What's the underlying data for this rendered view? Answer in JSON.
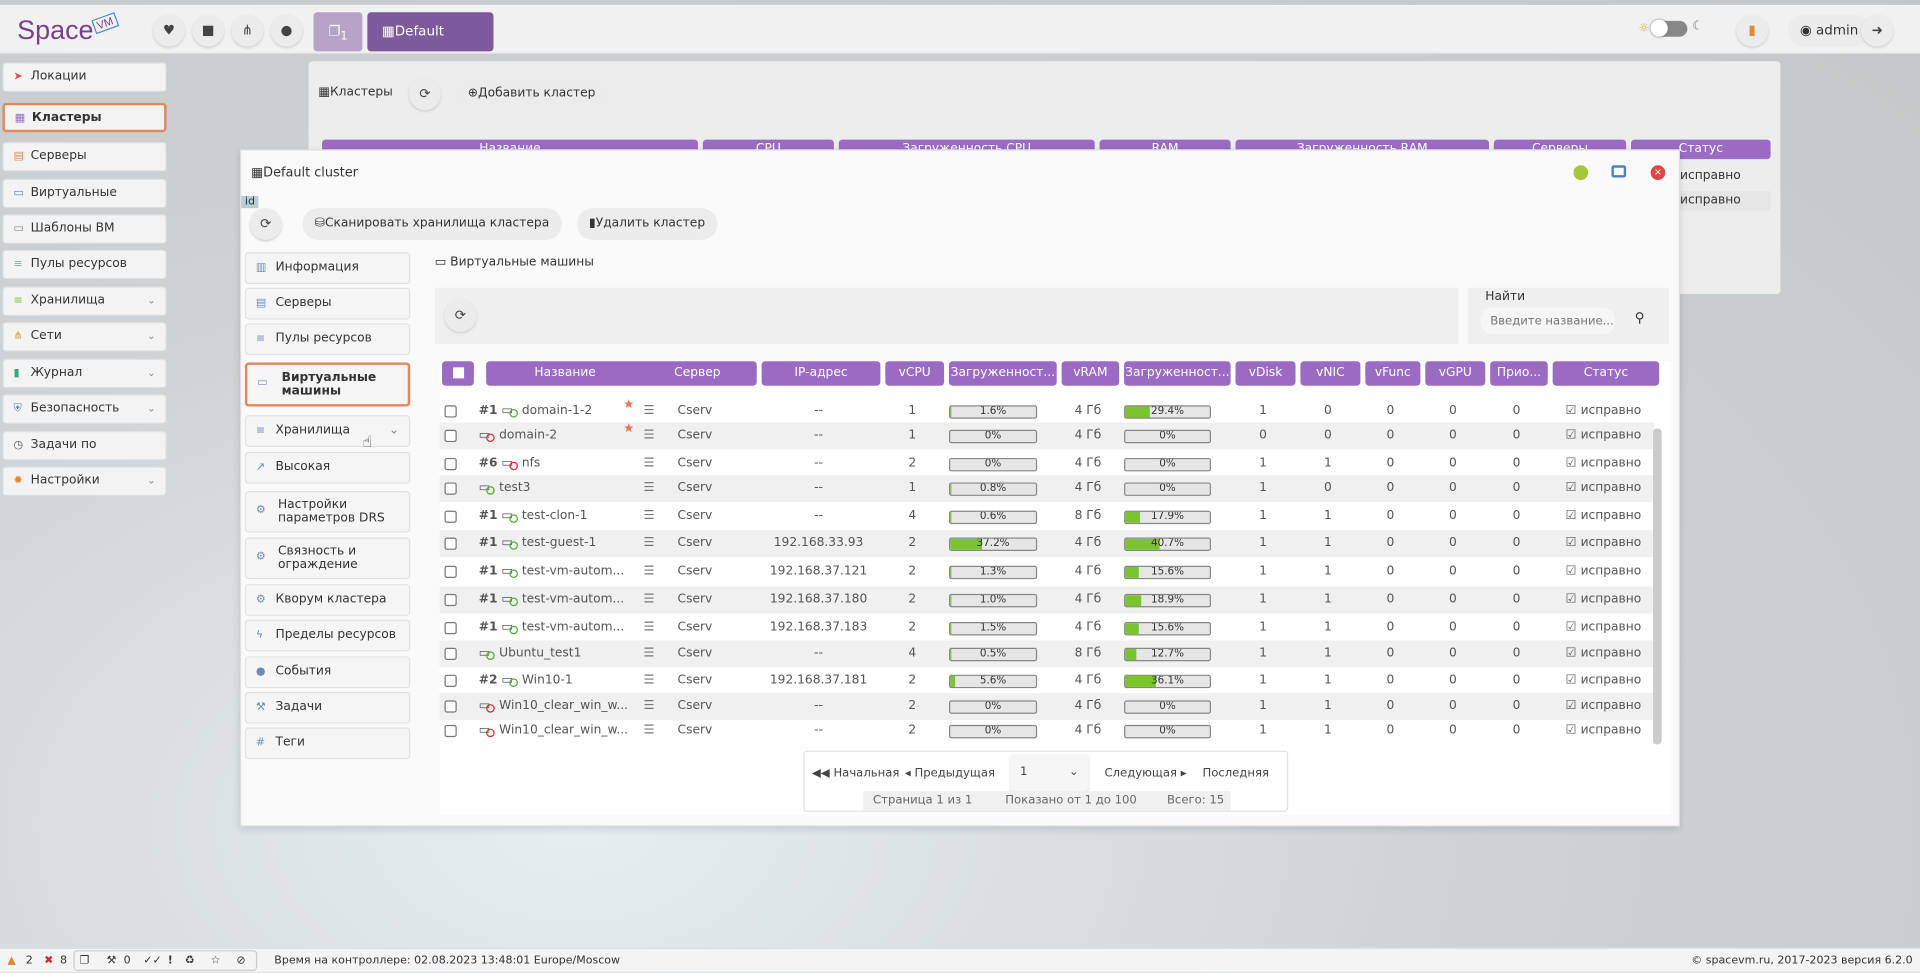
{
  "logo": {
    "text": "Space",
    "badge": "VM"
  },
  "topbar": {
    "icons": [
      "heartbeat-icon",
      "folder-icon",
      "sitemap-icon",
      "globe-icon"
    ],
    "windows_count": "1",
    "active_window": "Default cluster",
    "user": "admin"
  },
  "sidebar": {
    "items": [
      {
        "label": "Локации",
        "icon": "➤",
        "color": "#d9534f"
      },
      {
        "label": "Кластеры",
        "icon": "▦",
        "color": "#9b6bc4",
        "active": true
      },
      {
        "label": "Серверы",
        "icon": "▤",
        "color": "#e08a5c"
      },
      {
        "label": "Виртуальные машины",
        "icon": "▭",
        "color": "#5a7fb5"
      },
      {
        "label": "Шаблоны ВМ",
        "icon": "▭",
        "color": "#888"
      },
      {
        "label": "Пулы ресурсов",
        "icon": "≡",
        "color": "#8aa"
      },
      {
        "label": "Хранилища",
        "icon": "≡",
        "color": "#7ac52e",
        "chevron": true
      },
      {
        "label": "Сети",
        "icon": "⋔",
        "color": "#c9a227",
        "chevron": true
      },
      {
        "label": "Журнал",
        "icon": "▮",
        "color": "#3aa87a",
        "chevron": true
      },
      {
        "label": "Безопасность",
        "icon": "⛨",
        "color": "#5a7fb5",
        "chevron": true
      },
      {
        "label": "Задачи по расписанию",
        "icon": "◷",
        "color": "#555"
      },
      {
        "label": "Настройки",
        "icon": "✹",
        "color": "#e08a2c",
        "chevron": true
      }
    ]
  },
  "clusters_panel": {
    "title": "Кластеры",
    "add_label": "Добавить кластер",
    "headers": [
      "Название",
      "CPU",
      "Загруженность CPU",
      "RAM",
      "Загруженность RAM",
      "Серверы",
      "Статус"
    ],
    "status_values": [
      "исправно",
      "исправно"
    ]
  },
  "window": {
    "title": "Default cluster",
    "id_badge": "id",
    "scan_label": "Сканировать хранилища кластера",
    "delete_label": "Удалить кластер",
    "section_title": "Виртуальные машины",
    "search_label": "Найти",
    "search_placeholder": "Введите название...",
    "menu": [
      {
        "label": "Информация",
        "icon": "▥"
      },
      {
        "label": "Серверы",
        "icon": "▤"
      },
      {
        "label": "Пулы ресурсов",
        "icon": "≡"
      },
      {
        "label": "Виртуальные машины",
        "icon": "▭",
        "active": true
      },
      {
        "label": "Хранилища",
        "icon": "≡",
        "chevron": true
      },
      {
        "label": "Высокая доступность",
        "icon": "↗"
      },
      {
        "label": "Настройки параметров DRS",
        "icon": "⚙"
      },
      {
        "label": "Связность и ограждение",
        "icon": "⚙"
      },
      {
        "label": "Кворум кластера",
        "icon": "⚙"
      },
      {
        "label": "Пределы ресурсов",
        "icon": "ϟ"
      },
      {
        "label": "События",
        "icon": "●"
      },
      {
        "label": "Задачи",
        "icon": "⚒"
      },
      {
        "label": "Теги",
        "icon": "#"
      }
    ]
  },
  "table": {
    "headers": [
      "Название",
      "Сервер",
      "IP-адрес",
      "vCPU",
      "Загруженност...",
      "vRAM",
      "Загруженност...",
      "vDisk",
      "vNIC",
      "vFunc",
      "vGPU",
      "Прио...",
      "Статус"
    ],
    "rows": [
      {
        "tag": "#1",
        "name": "domain-1-2",
        "state": "running",
        "star": true,
        "server": "Cserv",
        "ip": "--",
        "vcpu": "1",
        "cpu": 1.6,
        "cpu_label": "1.6%",
        "vram": "4 Гб",
        "ram": 29.4,
        "ram_label": "29.4%",
        "vdisk": "1",
        "vnic": "0",
        "vfunc": "0",
        "vgpu": "0",
        "prio": "0",
        "status": "исправно"
      },
      {
        "tag": "",
        "name": "domain-2",
        "state": "stopped",
        "star": true,
        "server": "Cserv",
        "ip": "--",
        "vcpu": "1",
        "cpu": 0,
        "cpu_label": "0%",
        "vram": "4 Гб",
        "ram": 0,
        "ram_label": "0%",
        "vdisk": "0",
        "vnic": "0",
        "vfunc": "0",
        "vgpu": "0",
        "prio": "0",
        "status": "исправно"
      },
      {
        "tag": "#6",
        "name": "nfs",
        "state": "stopped",
        "server": "Cserv",
        "ip": "--",
        "vcpu": "2",
        "cpu": 0,
        "cpu_label": "0%",
        "vram": "4 Гб",
        "ram": 0,
        "ram_label": "0%",
        "vdisk": "1",
        "vnic": "1",
        "vfunc": "0",
        "vgpu": "0",
        "prio": "0",
        "status": "исправно"
      },
      {
        "tag": "",
        "name": "test3",
        "state": "running",
        "server": "Cserv",
        "ip": "--",
        "vcpu": "1",
        "cpu": 0.8,
        "cpu_label": "0.8%",
        "vram": "4 Гб",
        "ram": 0,
        "ram_label": "0%",
        "vdisk": "1",
        "vnic": "0",
        "vfunc": "0",
        "vgpu": "0",
        "prio": "0",
        "status": "исправно"
      },
      {
        "tag": "#1",
        "name": "test-clon-1",
        "state": "running",
        "server": "Cserv",
        "ip": "--",
        "vcpu": "4",
        "cpu": 0.6,
        "cpu_label": "0.6%",
        "vram": "8 Гб",
        "ram": 17.9,
        "ram_label": "17.9%",
        "vdisk": "1",
        "vnic": "1",
        "vfunc": "0",
        "vgpu": "0",
        "prio": "0",
        "status": "исправно"
      },
      {
        "tag": "#1",
        "name": "test-guest-1",
        "state": "running",
        "server": "Cserv",
        "ip": "192.168.33.93",
        "vcpu": "2",
        "cpu": 37.2,
        "cpu_label": "37.2%",
        "vram": "4 Гб",
        "ram": 40.7,
        "ram_label": "40.7%",
        "vdisk": "1",
        "vnic": "1",
        "vfunc": "0",
        "vgpu": "0",
        "prio": "0",
        "status": "исправно"
      },
      {
        "tag": "#1",
        "name": "test-vm-autom...",
        "state": "running",
        "server": "Cserv",
        "ip": "192.168.37.121",
        "vcpu": "2",
        "cpu": 1.3,
        "cpu_label": "1.3%",
        "vram": "4 Гб",
        "ram": 15.6,
        "ram_label": "15.6%",
        "vdisk": "1",
        "vnic": "1",
        "vfunc": "0",
        "vgpu": "0",
        "prio": "0",
        "status": "исправно"
      },
      {
        "tag": "#1",
        "name": "test-vm-autom...",
        "state": "running",
        "server": "Cserv",
        "ip": "192.168.37.180",
        "vcpu": "2",
        "cpu": 1.0,
        "cpu_label": "1.0%",
        "vram": "4 Гб",
        "ram": 18.9,
        "ram_label": "18.9%",
        "vdisk": "1",
        "vnic": "1",
        "vfunc": "0",
        "vgpu": "0",
        "prio": "0",
        "status": "исправно"
      },
      {
        "tag": "#1",
        "name": "test-vm-autom...",
        "state": "running",
        "server": "Cserv",
        "ip": "192.168.37.183",
        "vcpu": "2",
        "cpu": 1.5,
        "cpu_label": "1.5%",
        "vram": "4 Гб",
        "ram": 15.6,
        "ram_label": "15.6%",
        "vdisk": "1",
        "vnic": "1",
        "vfunc": "0",
        "vgpu": "0",
        "prio": "0",
        "status": "исправно"
      },
      {
        "tag": "",
        "name": "Ubuntu_test1",
        "state": "running",
        "server": "Cserv",
        "ip": "--",
        "vcpu": "4",
        "cpu": 0.5,
        "cpu_label": "0.5%",
        "vram": "8 Гб",
        "ram": 12.7,
        "ram_label": "12.7%",
        "vdisk": "1",
        "vnic": "1",
        "vfunc": "0",
        "vgpu": "0",
        "prio": "0",
        "status": "исправно"
      },
      {
        "tag": "#2",
        "name": "Win10-1",
        "state": "running",
        "server": "Cserv",
        "ip": "192.168.37.181",
        "vcpu": "2",
        "cpu": 5.6,
        "cpu_label": "5.6%",
        "vram": "4 Гб",
        "ram": 36.1,
        "ram_label": "36.1%",
        "vdisk": "1",
        "vnic": "1",
        "vfunc": "0",
        "vgpu": "0",
        "prio": "0",
        "status": "исправно"
      },
      {
        "tag": "",
        "name": "Win10_clear_win_w...",
        "state": "stopped",
        "server": "Cserv",
        "ip": "--",
        "vcpu": "2",
        "cpu": 0,
        "cpu_label": "0%",
        "vram": "4 Гб",
        "ram": 0,
        "ram_label": "0%",
        "vdisk": "1",
        "vnic": "1",
        "vfunc": "0",
        "vgpu": "0",
        "prio": "0",
        "status": "исправно"
      },
      {
        "tag": "",
        "name": "Win10_clear_win_w...",
        "state": "stopped",
        "server": "Cserv",
        "ip": "--",
        "vcpu": "2",
        "cpu": 0,
        "cpu_label": "0%",
        "vram": "4 Гб",
        "ram": 0,
        "ram_label": "0%",
        "vdisk": "1",
        "vnic": "1",
        "vfunc": "0",
        "vgpu": "0",
        "prio": "0",
        "status": "исправно"
      }
    ]
  },
  "pagination": {
    "first": "Начальная",
    "prev": "Предыдущая",
    "page": "1",
    "next": "Следующая",
    "last": "Последняя",
    "page_info": "Страница 1 из 1",
    "shown": "Показано от 1 до 100",
    "total": "Всего: 15"
  },
  "statusbar": {
    "warnings": "2",
    "errors": "8",
    "tasks": "0",
    "time": "Время на контроллере: 02.08.2023 13:48:01 Europe/Moscow",
    "copyright": "© spacevm.ru, 2017-2023 версия 6.2.0"
  },
  "colors": {
    "accent": "#9b6bc4",
    "running": "#4caf2a",
    "stopped": "#d9262c",
    "load_fill": "#7ac52e"
  }
}
